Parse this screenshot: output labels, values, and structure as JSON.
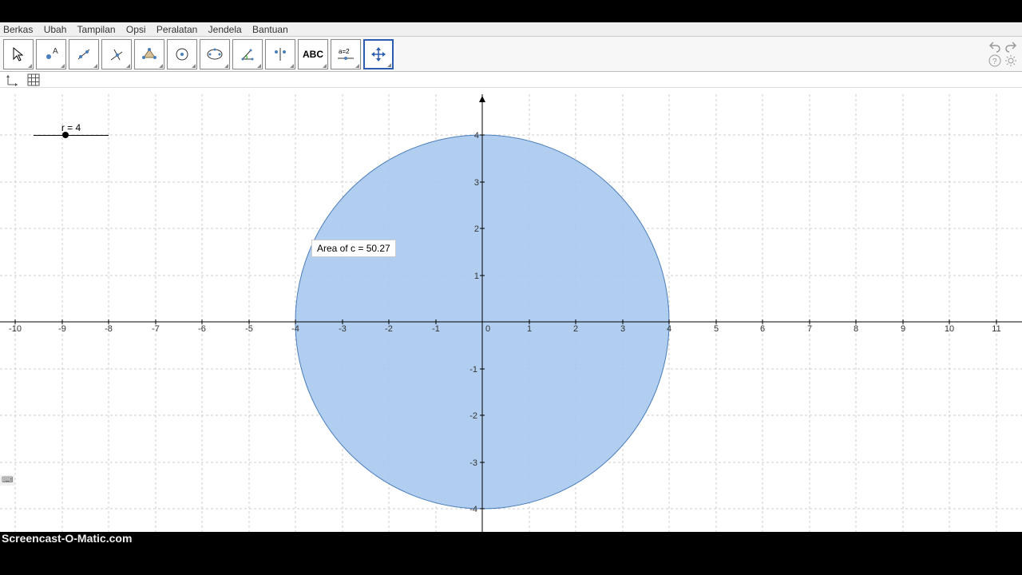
{
  "menu": {
    "items": [
      "Berkas",
      "Ubah",
      "Tampilan",
      "Opsi",
      "Peralatan",
      "Jendela",
      "Bantuan"
    ]
  },
  "toolbar": {
    "tools": [
      "move",
      "point",
      "line",
      "perpendicular",
      "polygon",
      "circle",
      "ellipse",
      "angle",
      "reflect",
      "text",
      "slider",
      "translate"
    ],
    "selected_index": 11,
    "text_label": "ABC",
    "slider_label": "a=2"
  },
  "slider": {
    "label": "r = 4"
  },
  "area_text": "Area of c = 50.27",
  "axes": {
    "x_labels": [
      "-10",
      "-9",
      "-8",
      "-7",
      "-6",
      "-5",
      "-4",
      "-3",
      "-2",
      "-1",
      "0",
      "1",
      "2",
      "3",
      "4",
      "5",
      "6",
      "7",
      "8",
      "9",
      "10",
      "11"
    ],
    "y_labels_pos": [
      "4",
      "3",
      "2",
      "1",
      "0"
    ],
    "y_labels_neg": [
      "-1",
      "-2",
      "-3",
      "-4"
    ]
  },
  "watermark": "Screencast-O-Matic.com",
  "chart_data": {
    "type": "scatter",
    "title": "",
    "circle": {
      "cx": 0,
      "cy": 0,
      "r": 4
    },
    "area_value": 50.27,
    "slider_var": "r",
    "slider_value": 4,
    "xlim": [
      -10,
      11
    ],
    "ylim": [
      -4,
      4
    ],
    "xlabel": "",
    "ylabel": ""
  }
}
